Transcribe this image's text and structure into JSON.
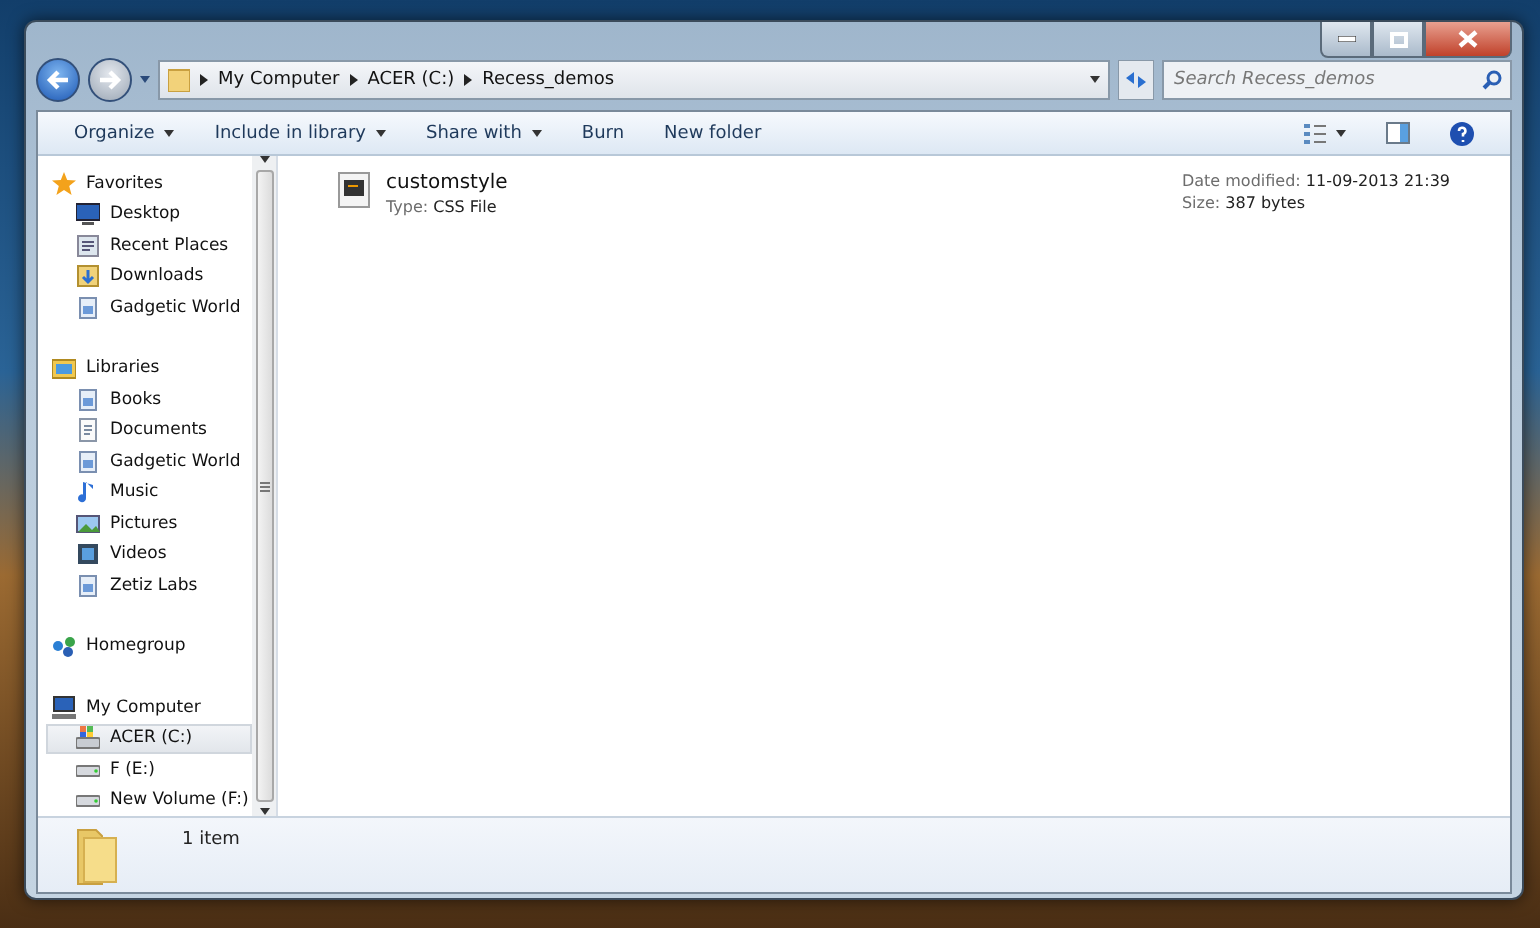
{
  "breadcrumb": [
    "My Computer",
    "ACER (C:)",
    "Recess_demos"
  ],
  "search": {
    "placeholder": "Search Recess_demos"
  },
  "toolbar": [
    {
      "label": "Organize",
      "dropdown": true
    },
    {
      "label": "Include in library",
      "dropdown": true
    },
    {
      "label": "Share with",
      "dropdown": true
    },
    {
      "label": "Burn",
      "dropdown": false
    },
    {
      "label": "New folder",
      "dropdown": false
    }
  ],
  "sidebar": {
    "groups": [
      {
        "label": "Favorites",
        "kind": "star",
        "children": [
          {
            "label": "Desktop",
            "kind": "desktop",
            "selected": false
          },
          {
            "label": "Recent Places",
            "kind": "recent",
            "selected": false
          },
          {
            "label": "Downloads",
            "kind": "download",
            "selected": false
          },
          {
            "label": "Gadgetic World",
            "kind": "library",
            "selected": false
          }
        ]
      },
      {
        "label": "Libraries",
        "kind": "libraries",
        "children": [
          {
            "label": "Books",
            "kind": "library",
            "selected": false
          },
          {
            "label": "Documents",
            "kind": "document",
            "selected": false
          },
          {
            "label": "Gadgetic World",
            "kind": "library",
            "selected": false
          },
          {
            "label": "Music",
            "kind": "music",
            "selected": false
          },
          {
            "label": "Pictures",
            "kind": "picture",
            "selected": false
          },
          {
            "label": "Videos",
            "kind": "video",
            "selected": false
          },
          {
            "label": "Zetiz Labs",
            "kind": "library",
            "selected": false
          }
        ]
      },
      {
        "label": "Homegroup",
        "kind": "homegroup"
      },
      {
        "label": "My Computer",
        "kind": "computer",
        "children": [
          {
            "label": "ACER (C:)",
            "kind": "system-drive",
            "selected": true
          },
          {
            "label": "F (E:)",
            "kind": "drive",
            "selected": false
          },
          {
            "label": "New Volume (F:)",
            "kind": "drive",
            "selected": false
          }
        ]
      }
    ]
  },
  "files": [
    {
      "name": "customstyle",
      "type_label": "Type:",
      "type": "CSS File",
      "date_label": "Date modified:",
      "date": "11-09-2013 21:39",
      "size_label": "Size:",
      "size": "387 bytes"
    }
  ],
  "status": {
    "count": "1 item"
  }
}
